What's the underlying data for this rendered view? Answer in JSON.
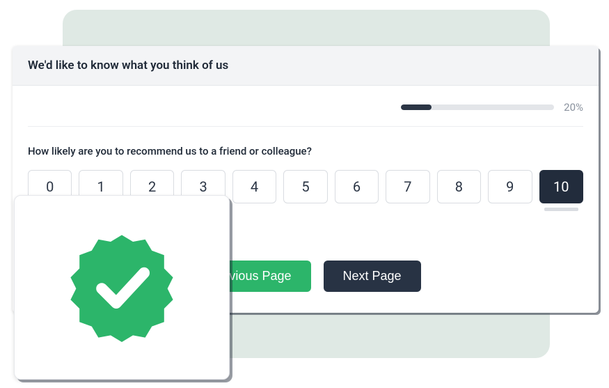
{
  "header": {
    "title": "We'd like to know what you think of us"
  },
  "progress": {
    "percent": 20,
    "label": "20%"
  },
  "question": {
    "text": "How likely are you to recommend us to a friend or colleague?",
    "options": [
      "0",
      "1",
      "2",
      "3",
      "4",
      "5",
      "6",
      "7",
      "8",
      "9",
      "10"
    ],
    "selected": "10"
  },
  "nav": {
    "prev_label": "Previous Page",
    "next_label": "Next Page"
  },
  "badge": {
    "icon": "verified-check",
    "color": "#2cb56a"
  }
}
